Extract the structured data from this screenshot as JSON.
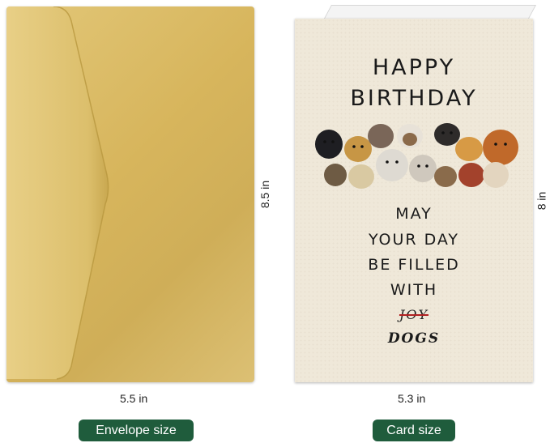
{
  "envelope": {
    "width_label": "5.5 in",
    "height_label": "8.5 in",
    "badge": "Envelope size",
    "color": "#d7b55c"
  },
  "card": {
    "width_label": "5.3 in",
    "height_label": "8 in",
    "badge": "Card size",
    "line1": "HAPPY",
    "line2": "BIRTHDAY",
    "line3": "MAY",
    "line4": "YOUR DAY",
    "line5": "BE FILLED",
    "line6": "WITH",
    "crossed_word": "JOY",
    "replacement_word": "DOGS",
    "background": "#efe8d9"
  },
  "badge_color": "#1f5c3c"
}
